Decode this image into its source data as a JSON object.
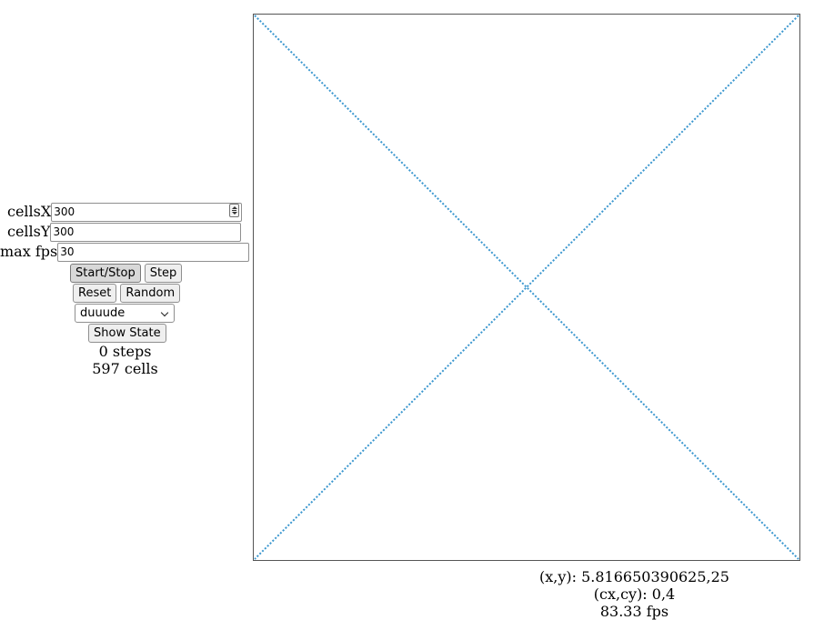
{
  "controls": {
    "cells_x": {
      "label": "cellsX",
      "value": "300"
    },
    "cells_y": {
      "label": "cellsY",
      "value": "300"
    },
    "max_fps": {
      "label": "max fps",
      "value": "30"
    },
    "start_stop_label": "Start/Stop",
    "step_label": "Step",
    "reset_label": "Reset",
    "random_label": "Random",
    "rule_select": {
      "selected": "duuude"
    },
    "show_state_label": "Show State"
  },
  "stats": {
    "steps": "0 steps",
    "cells": "597 cells"
  },
  "readout": {
    "xy": "(x,y): 5.816650390625,25",
    "cxcy": "(cx,cy): 0,4",
    "fps": "83.33 fps"
  },
  "colors": {
    "cell_color": "#3b97cf"
  }
}
